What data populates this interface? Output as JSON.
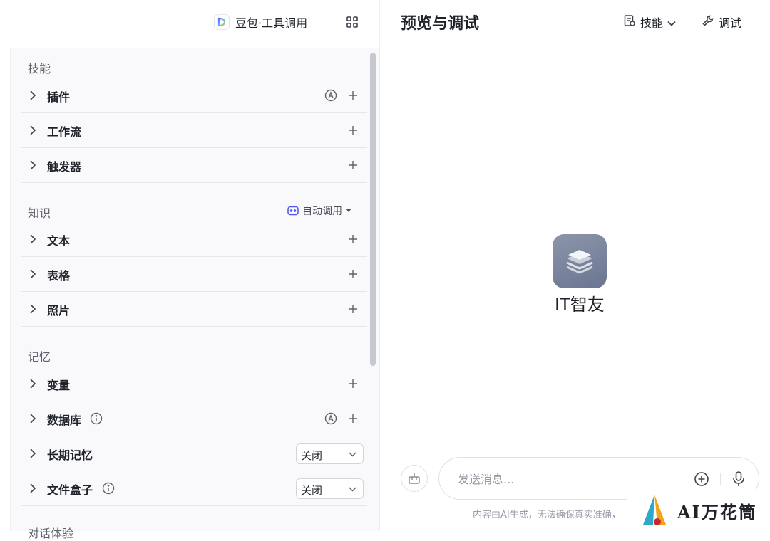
{
  "header": {
    "model_name": "豆包·工具调用",
    "preview_title": "预览与调试",
    "skill_label": "技能",
    "debug_label": "调试"
  },
  "sections": {
    "skills": {
      "title": "技能",
      "items": [
        {
          "label": "插件"
        },
        {
          "label": "工作流"
        },
        {
          "label": "触发器"
        }
      ]
    },
    "knowledge": {
      "title": "知识",
      "auto_invoke": "自动调用",
      "items": [
        {
          "label": "文本"
        },
        {
          "label": "表格"
        },
        {
          "label": "照片"
        }
      ]
    },
    "memory": {
      "title": "记忆",
      "items": [
        {
          "label": "变量"
        },
        {
          "label": "数据库"
        },
        {
          "label": "长期记忆",
          "value": "关闭"
        },
        {
          "label": "文件盒子",
          "value": "关闭"
        }
      ]
    },
    "dialog": {
      "title": "对话体验"
    }
  },
  "preview": {
    "bot_name": "IT智友",
    "input_placeholder": "发送消息...",
    "disclaimer": "内容由AI生成，无法确保真实准确，"
  },
  "watermark": {
    "text": "AI万花筒"
  },
  "colors": {
    "panel_bg": "#f9f9fc",
    "avatar_bg": "#7b849b",
    "accent_purple": "#4d53e8"
  }
}
